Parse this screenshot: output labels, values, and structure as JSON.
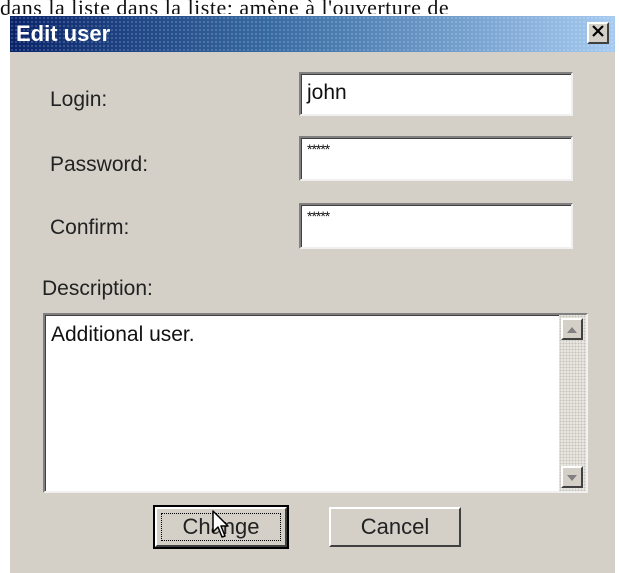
{
  "background_text": "dans la liste dans la liste; amène à l'ouverture de",
  "dialog": {
    "title": "Edit user",
    "close_icon": "close-x-icon"
  },
  "form": {
    "login": {
      "label": "Login:",
      "value": "john"
    },
    "password": {
      "label": "Password:",
      "value": "*****"
    },
    "confirm": {
      "label": "Confirm:",
      "value": "*****"
    },
    "description": {
      "label": "Description:",
      "value": "Additional user."
    }
  },
  "buttons": {
    "change_label": "Change",
    "cancel_label": "Cancel"
  },
  "icons": {
    "scroll_up": "scroll-up-arrow-icon",
    "scroll_down": "scroll-down-arrow-icon",
    "cursor": "mouse-pointer-icon"
  },
  "colors": {
    "titlebar_start": "#0a246a",
    "titlebar_end": "#a6caf0",
    "dialog_face": "#d4d0c8"
  }
}
